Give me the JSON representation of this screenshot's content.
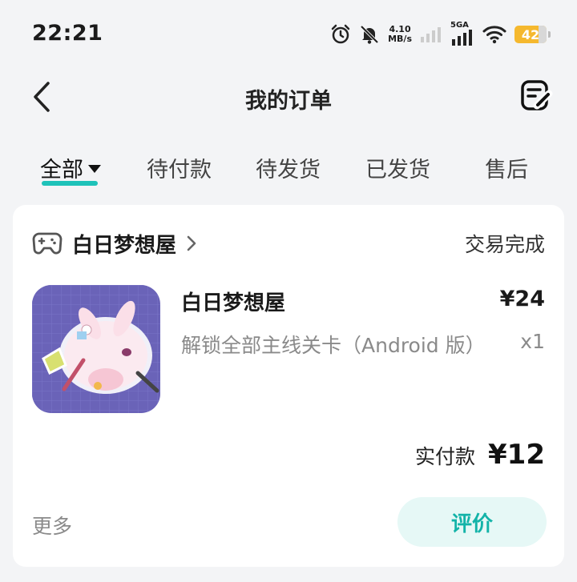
{
  "status_bar": {
    "time": "22:21",
    "net_speed_value": "4.10",
    "net_speed_unit": "MB/s",
    "signal_label": "5GA",
    "battery": "42",
    "icons": [
      "alarm-icon",
      "bell-off-icon",
      "signal-empty-icon",
      "signal-5g-icon",
      "wifi-icon",
      "battery-icon"
    ]
  },
  "header": {
    "title": "我的订单",
    "back_icon": "chevron-left-icon",
    "edit_icon": "edit-note-icon"
  },
  "tabs": [
    {
      "label": "全部",
      "active": true
    },
    {
      "label": "待付款",
      "active": false
    },
    {
      "label": "待发货",
      "active": false
    },
    {
      "label": "已发货",
      "active": false
    },
    {
      "label": "售后",
      "active": false
    }
  ],
  "order": {
    "shop_icon": "gamepad-icon",
    "shop_name": "白日梦想屋",
    "status": "交易完成",
    "product_name": "白日梦想屋",
    "price": "¥24",
    "description": "解锁全部主线关卡（Android 版）",
    "quantity": "x1",
    "paid_label": "实付款",
    "paid_value": "¥12",
    "more_label": "更多",
    "review_label": "评价"
  },
  "colors": {
    "accent": "#1ec2b9",
    "review_bg": "#e6f8f6",
    "review_text": "#12b3a8",
    "battery": "#f5b82e",
    "page_bg": "#f3f4f6"
  }
}
